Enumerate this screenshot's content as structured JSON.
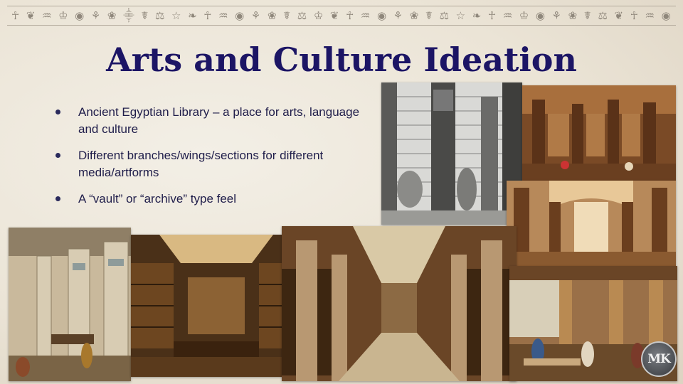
{
  "slide": {
    "title": "Arts and Culture Ideation",
    "bullets": [
      "Ancient Egyptian Library – a place for arts, language and culture",
      "Different branches/wings/sections for different media/artforms",
      "A “vault” or “archive” type feel"
    ]
  },
  "decoration": {
    "hieroglyph_glyphs": [
      "☥",
      "❦",
      "♒",
      "♔",
      "◉",
      "⚘",
      "❀",
      "⸎",
      "☤",
      "⚖",
      "☆",
      "❧",
      "☥",
      "♒",
      "◉",
      "⚘",
      "❀",
      "☤",
      "⚖",
      "♔",
      "❦",
      "☥",
      "♒",
      "◉",
      "⚘",
      "❀",
      "☤",
      "⚖",
      "☆",
      "❧",
      "☥",
      "♒",
      "♔",
      "◉",
      "⚘",
      "❀",
      "☤",
      "⚖",
      "❦",
      "☥",
      "♒",
      "◉"
    ],
    "logo_monogram": "MK"
  },
  "colors": {
    "title": "#1c1565",
    "body_text": "#1f1d4a",
    "background": "#ece6da"
  }
}
